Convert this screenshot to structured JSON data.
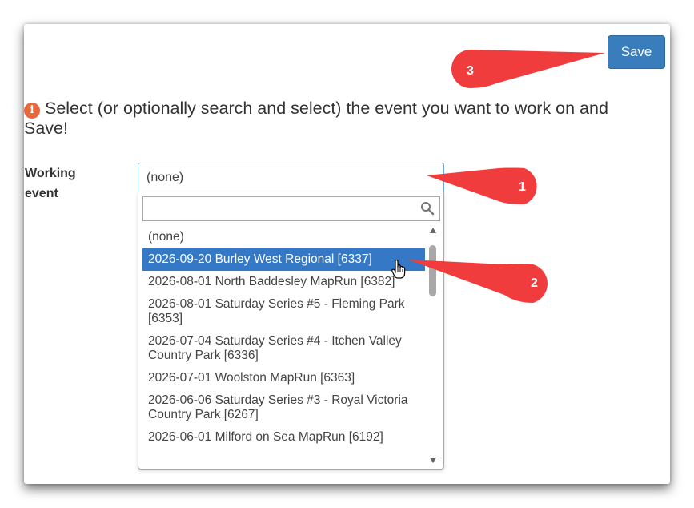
{
  "header": {
    "save_label": "Save"
  },
  "info": {
    "message": "Select (or optionally search and select) the event you want to work on and Save!"
  },
  "form": {
    "label": "Working event",
    "selected": "(none)",
    "search_value": "",
    "options": [
      "(none)",
      "2026-09-20 Burley West Regional [6337]",
      "2026-08-01 North Baddesley MapRun [6382]",
      "2026-08-01 Saturday Series #5 - Fleming Park [6353]",
      "2026-07-04 Saturday Series #4 - Itchen Valley Country Park [6336]",
      "2026-07-01 Woolston MapRun [6363]",
      "2026-06-06 Saturday Series #3 - Royal Victoria Country Park [6267]",
      "2026-06-01 Milford on Sea MapRun [6192]"
    ],
    "highlighted_index": 1
  },
  "annotations": {
    "callout_1": "1",
    "callout_2": "2",
    "callout_3": "3",
    "color": "#f03c3c"
  },
  "colors": {
    "save": "#3a7dbd",
    "highlight": "#3578c6",
    "info_icon": "#e8673c"
  },
  "icons": [
    "info-icon",
    "search-icon",
    "scroll-up-icon",
    "scroll-down-icon",
    "hand-cursor-icon"
  ]
}
